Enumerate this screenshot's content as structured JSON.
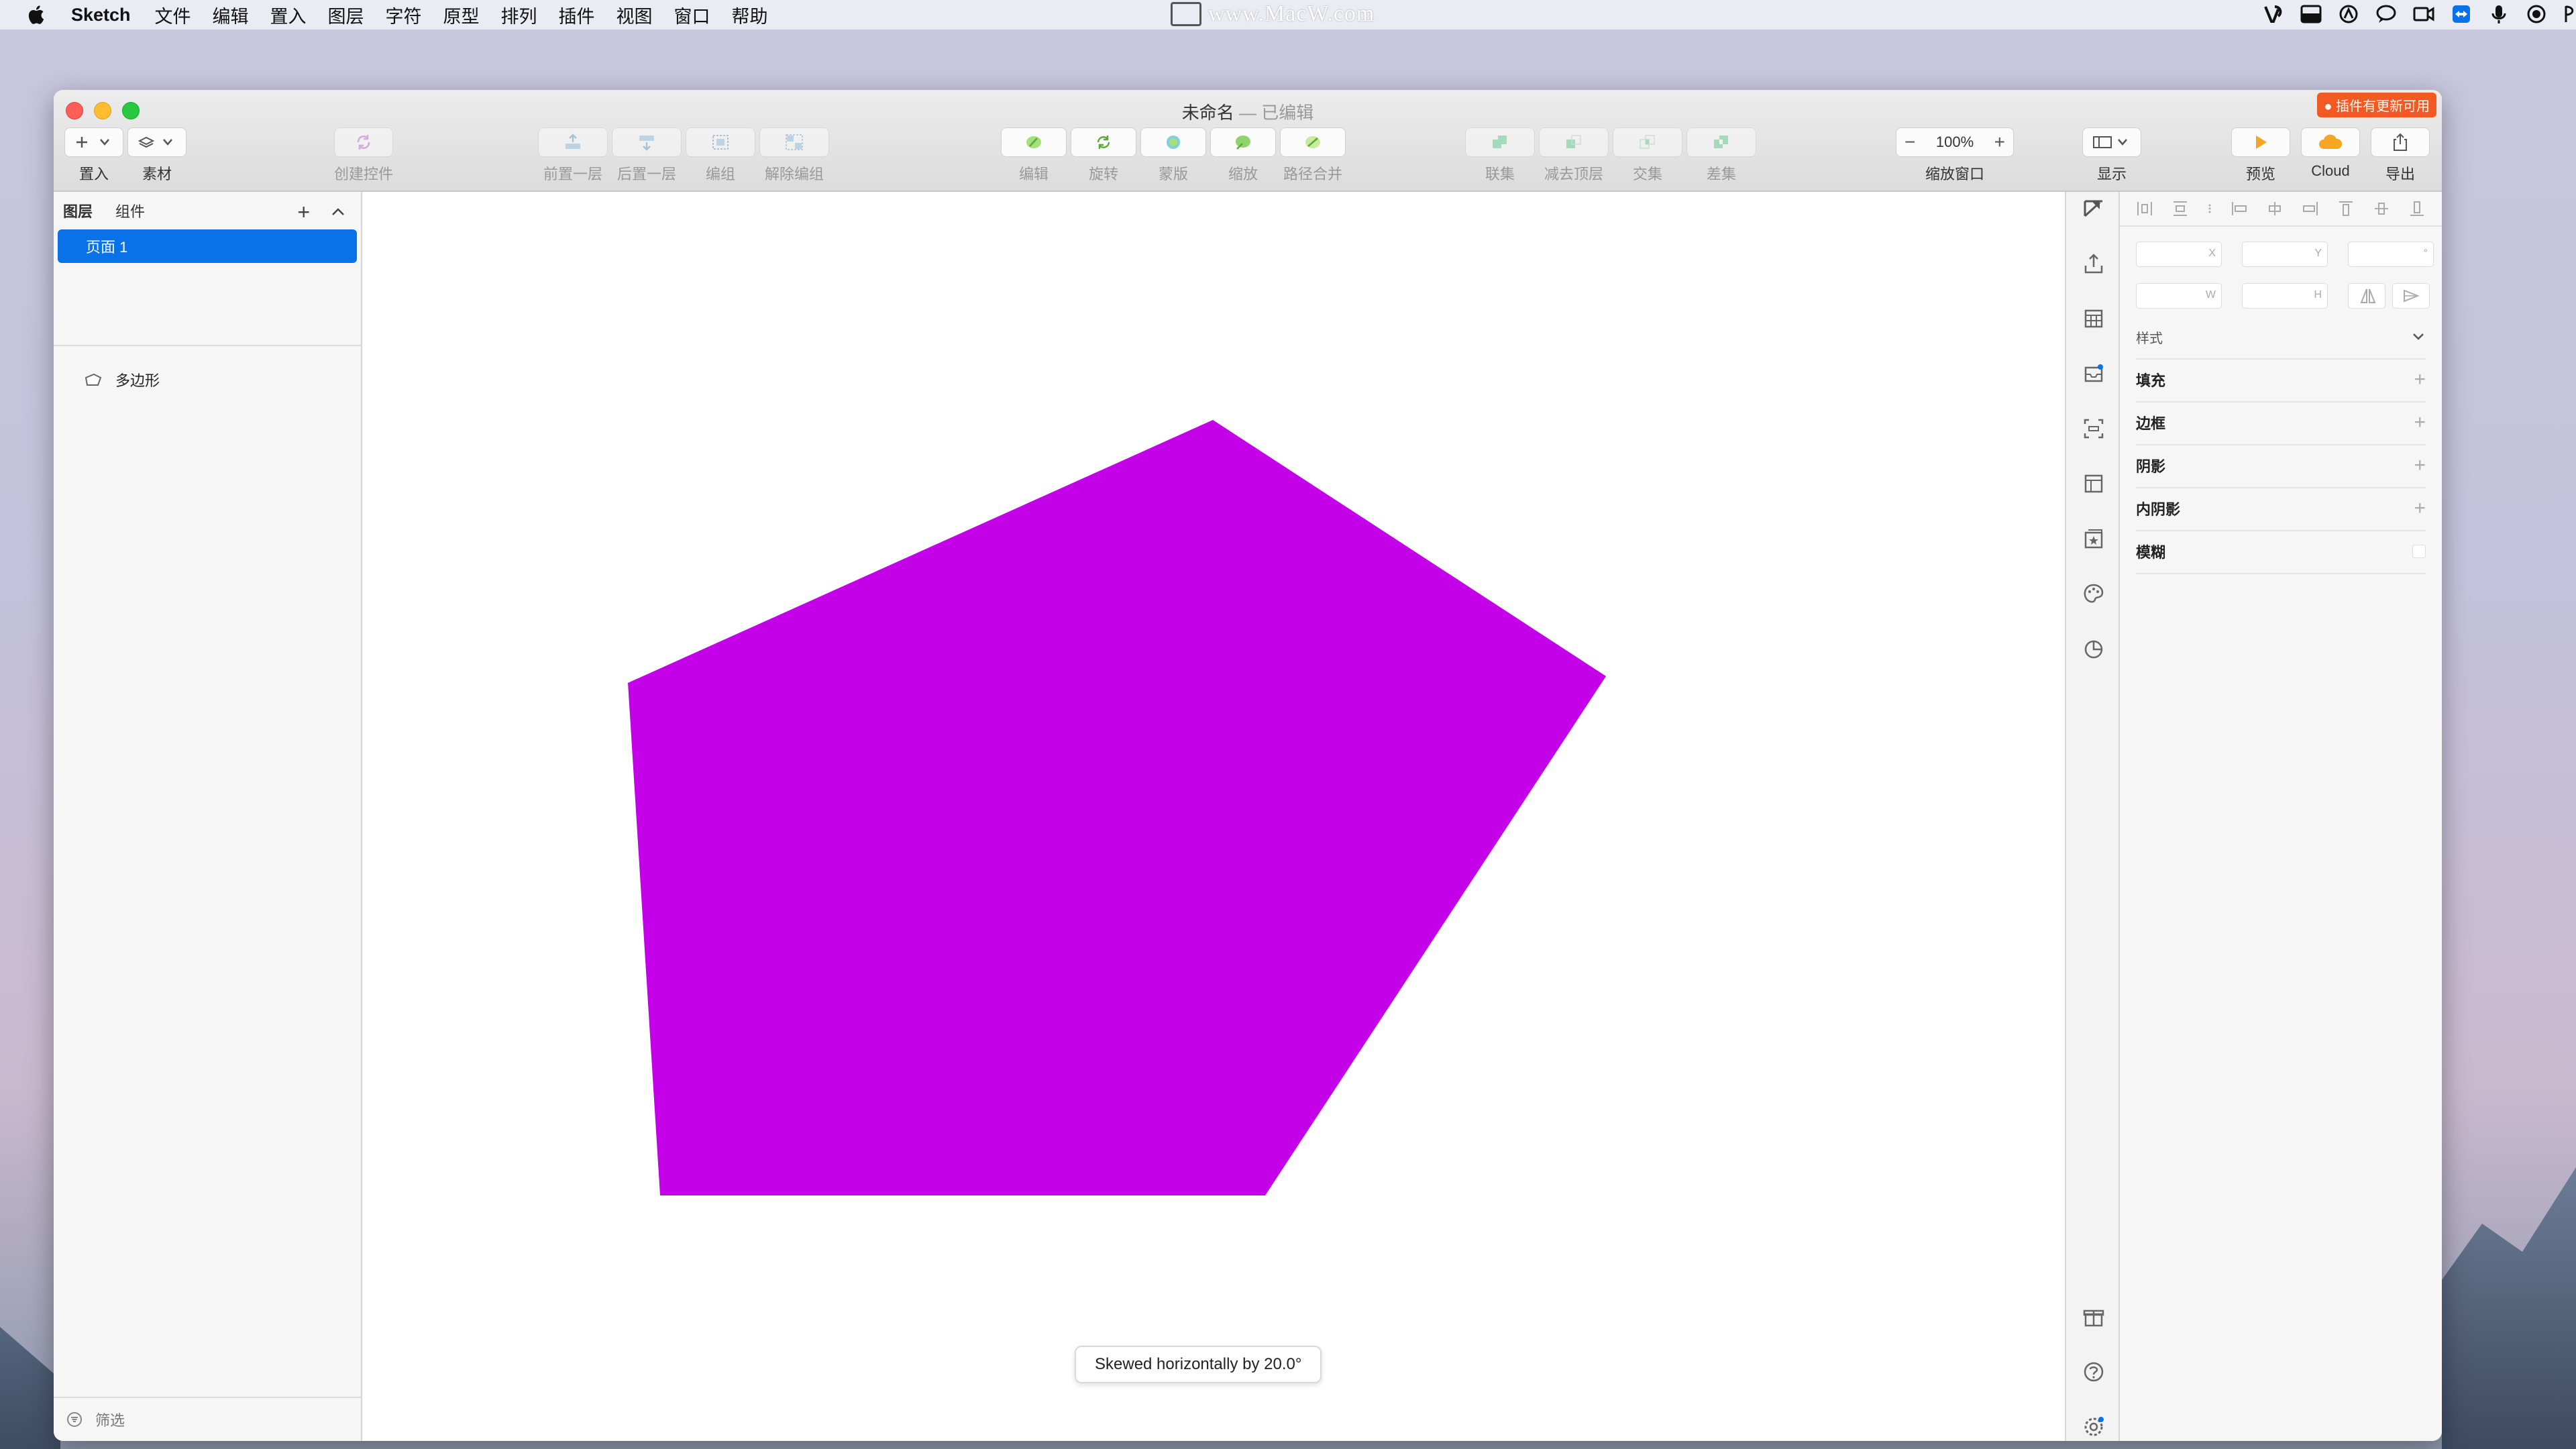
{
  "menubar": {
    "app_name": "Sketch",
    "items": [
      "文件",
      "编辑",
      "置入",
      "图层",
      "字符",
      "原型",
      "排列",
      "插件",
      "视图",
      "窗口",
      "帮助"
    ],
    "watermark": "www.MacW.com"
  },
  "window": {
    "title": "未命名",
    "title_suffix": " — 已编辑",
    "update_badge": "● 插件有更新可用"
  },
  "toolbar": {
    "insert_label": "置入",
    "assets_label": "素材",
    "create_symbol_label": "创建控件",
    "forward_label": "前置一层",
    "backward_label": "后置一层",
    "group_label": "编组",
    "ungroup_label": "解除编组",
    "edit_label": "编辑",
    "rotate_label": "旋转",
    "mask_label": "蒙版",
    "scale_label": "缩放",
    "flatten_label": "路径合并",
    "union_label": "联集",
    "subtract_label": "减去顶层",
    "intersect_label": "交集",
    "difference_label": "差集",
    "zoom_value": "100%",
    "zoom_label": "缩放窗口",
    "view_label": "显示",
    "preview_label": "预览",
    "cloud_label": "Cloud",
    "export_label": "导出"
  },
  "left_panel": {
    "tab_layers": "图层",
    "tab_components": "组件",
    "page_name": "页面 1",
    "layer_name": "多边形",
    "filter_label": "筛选"
  },
  "canvas": {
    "shape_color": "#c400e9",
    "toast": "Skewed horizontally by 20.0°"
  },
  "inspector": {
    "x_label": "X",
    "y_label": "Y",
    "rotation_label": "°",
    "w_label": "W",
    "h_label": "H",
    "style_label": "样式",
    "fill_label": "填充",
    "border_label": "边框",
    "shadow_label": "阴影",
    "inner_shadow_label": "内阴影",
    "blur_label": "模糊"
  },
  "colors": {
    "accent": "#0a72e8",
    "preview_orange": "#f5a623",
    "badge": "#f15a22"
  }
}
